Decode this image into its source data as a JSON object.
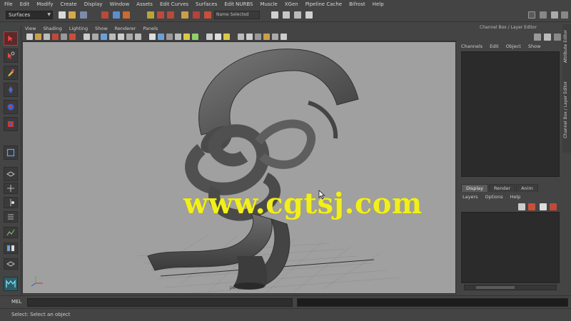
{
  "menubar": {
    "items": [
      "File",
      "Edit",
      "Modify",
      "Create",
      "Display",
      "Window",
      "Assets",
      "Edit Curves",
      "Surfaces",
      "Edit NURBS",
      "Muscle",
      "XGen",
      "Pipeline Cache",
      "Bifrost",
      "Help"
    ]
  },
  "statusline": {
    "mode": "Surfaces",
    "name_field": "Name Selected"
  },
  "panel": {
    "menu": [
      "View",
      "Shading",
      "Lighting",
      "Show",
      "Renderer",
      "Panels"
    ],
    "camera_label": "persp"
  },
  "viewport": {
    "background": "#a0a0a0",
    "watermark": "www.cgtsj.com",
    "watermark_color": "#f2ef1a"
  },
  "channel_box": {
    "title": "Channel Box / Layer Editor",
    "menu": [
      "Channels",
      "Edit",
      "Object",
      "Show"
    ]
  },
  "layer_editor": {
    "tabs": [
      "Display",
      "Render",
      "Anim"
    ],
    "active_tab": "Display",
    "menu": [
      "Layers",
      "Options",
      "Help"
    ]
  },
  "side_tabs": [
    "Attribute Editor",
    "Channel Box / Layer Editor"
  ],
  "command_line": {
    "label": "MEL"
  },
  "help_line": {
    "text": "Select: Select an object"
  },
  "colors": {
    "ui_background": "#444444",
    "panel_dark": "#2b2b2b",
    "select_tool": "#c0392b",
    "accent_yellow": "#f2ef1a"
  }
}
